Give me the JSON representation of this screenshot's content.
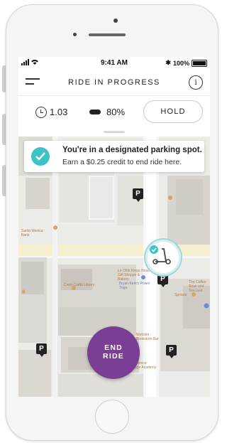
{
  "status_bar": {
    "time": "9:41 AM",
    "battery": "100%",
    "signal": "signal-wifi"
  },
  "nav": {
    "title": "RIDE IN PROGRESS",
    "menu_icon": "menu-icon",
    "info_icon": "info-icon"
  },
  "stats": {
    "ride_time": "1.03",
    "battery_level": "80%",
    "hold_label": "HOLD"
  },
  "notice": {
    "title": "You're in a designated parking spot.",
    "subtitle": "Earn a $0.25 credit to end ride here."
  },
  "map": {
    "parking_marker": "P",
    "labels": [
      {
        "text": "Le Oldo Kings Head Gift Shoppe & Bakery"
      },
      {
        "text": "Bryan Kent's Power Yoga"
      },
      {
        "text": "Crest Crafts Library"
      },
      {
        "text": "The Coffee Bean and Tea Leaf"
      },
      {
        "text": "Sprouts"
      },
      {
        "text": "Santa Monica Language Academy"
      },
      {
        "text": "Webster Bookstore Bar"
      },
      {
        "text": "Santa Monica Bank"
      }
    ]
  },
  "end_ride": {
    "line1": "END",
    "line2": "RIDE"
  },
  "colors": {
    "accent_teal": "#3cc3c5",
    "end_ride_purple": "#7a3f94"
  }
}
